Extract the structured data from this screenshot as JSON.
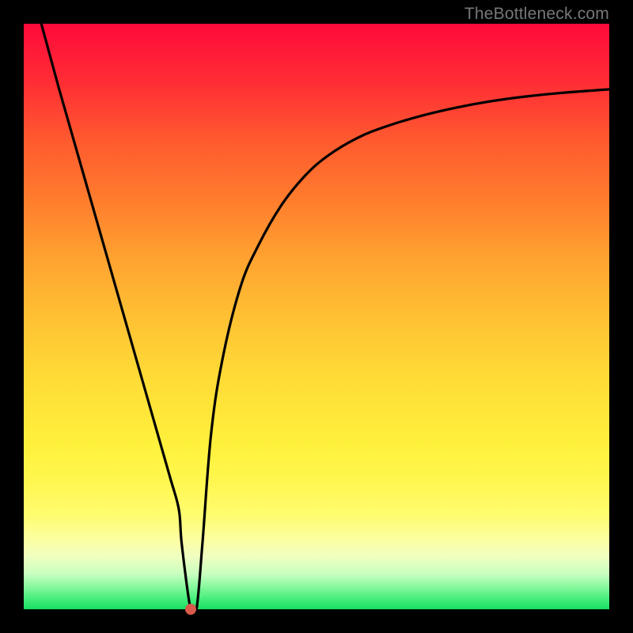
{
  "watermark": "TheBottleneck.com",
  "colors": {
    "page_bg": "#000000",
    "curve_stroke": "#000000",
    "marker_fill": "#d85a4a",
    "gradient_top": "#ff0a3a",
    "gradient_bottom": "#18e060"
  },
  "chart_data": {
    "type": "line",
    "title": "",
    "xlabel": "",
    "ylabel": "",
    "xlim": [
      0,
      100
    ],
    "ylim": [
      0,
      100
    ],
    "grid": false,
    "legend": false,
    "series": [
      {
        "name": "curve",
        "x": [
          3,
          6,
          10,
          14,
          18,
          22,
          25,
          26.5,
          27,
          28.5,
          29.5,
          30.5,
          32,
          34,
          37,
          40,
          44,
          48,
          52,
          57,
          62,
          68,
          74,
          80,
          86,
          92,
          100
        ],
        "y": [
          100,
          89,
          75,
          61,
          47,
          33,
          22.5,
          17,
          11,
          0,
          0,
          11,
          30,
          43,
          55,
          62,
          69,
          74,
          77.5,
          80.5,
          82.5,
          84.3,
          85.7,
          86.8,
          87.6,
          88.2,
          88.8
        ]
      }
    ],
    "marker": {
      "x": 28.5,
      "y": 0
    }
  }
}
